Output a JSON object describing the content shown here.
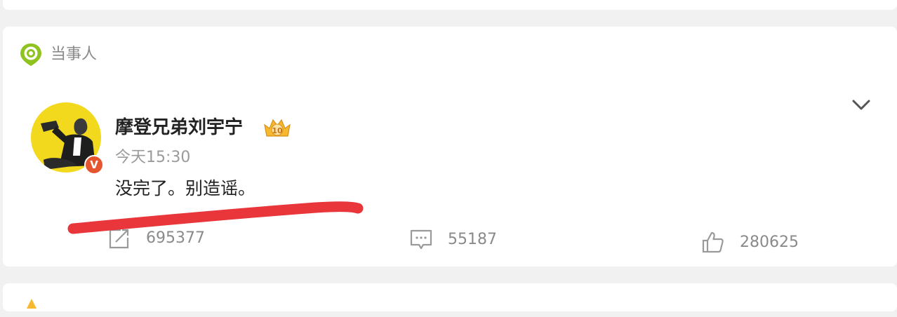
{
  "section": {
    "title": "当事人",
    "icon": "location-pin-icon"
  },
  "post": {
    "username": "摩登兄弟刘宇宁",
    "verified_badge": "V",
    "level_badge_text": "10",
    "timestamp": "今天15:30",
    "text": "没完了。别造谣。",
    "actions": {
      "repost_count": "695377",
      "comment_count": "55187",
      "like_count": "280625"
    },
    "menu_icon": "chevron-down-icon"
  },
  "colors": {
    "accent_green": "#8fc31f",
    "verified_orange": "#e5552f",
    "annotation_red": "#e8363a",
    "level_gold": "#f5b82e"
  }
}
